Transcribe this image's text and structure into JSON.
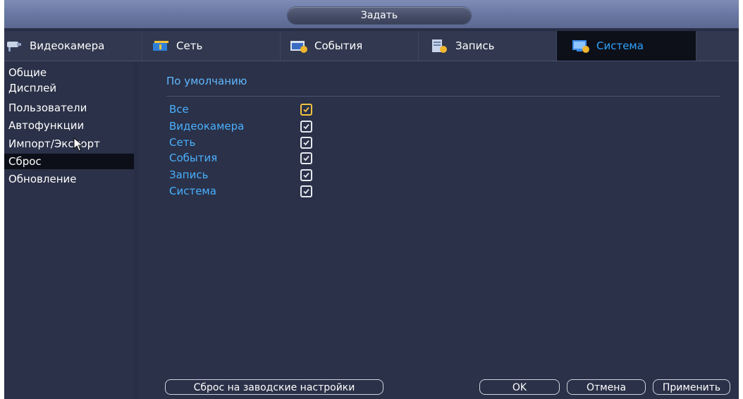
{
  "window": {
    "title": "Задать"
  },
  "tabs": [
    {
      "label": "Видеокамера",
      "icon": "camera-icon"
    },
    {
      "label": "Сеть",
      "icon": "network-icon"
    },
    {
      "label": "События",
      "icon": "events-icon"
    },
    {
      "label": "Запись",
      "icon": "record-icon"
    },
    {
      "label": "Система",
      "icon": "system-icon",
      "active": true
    }
  ],
  "sidebar": {
    "items": [
      {
        "label": "Общие"
      },
      {
        "label": "Дисплей"
      },
      {
        "label": "Пользователи"
      },
      {
        "label": "Автофункции"
      },
      {
        "label": "Импорт/Экспорт"
      },
      {
        "label": "Сброс",
        "active": true
      },
      {
        "label": "Обновление"
      }
    ]
  },
  "main": {
    "section_title": "По умолчанию",
    "options": [
      {
        "label": "Все",
        "checked": true,
        "style": "gold"
      },
      {
        "label": "Видеокамера",
        "checked": true
      },
      {
        "label": "Сеть",
        "checked": true
      },
      {
        "label": "События",
        "checked": true
      },
      {
        "label": "Запись",
        "checked": true
      },
      {
        "label": "Система",
        "checked": true
      }
    ]
  },
  "footer": {
    "factory_reset_label": "Сброс на заводские настройки",
    "ok_label": "OK",
    "cancel_label": "Отмена",
    "apply_label": "Применить"
  },
  "colors": {
    "background": "#272e45",
    "accent_text": "#4ab0ff",
    "active_tab_text": "#2fa4ff",
    "checkbox_all": "#f3c341"
  }
}
